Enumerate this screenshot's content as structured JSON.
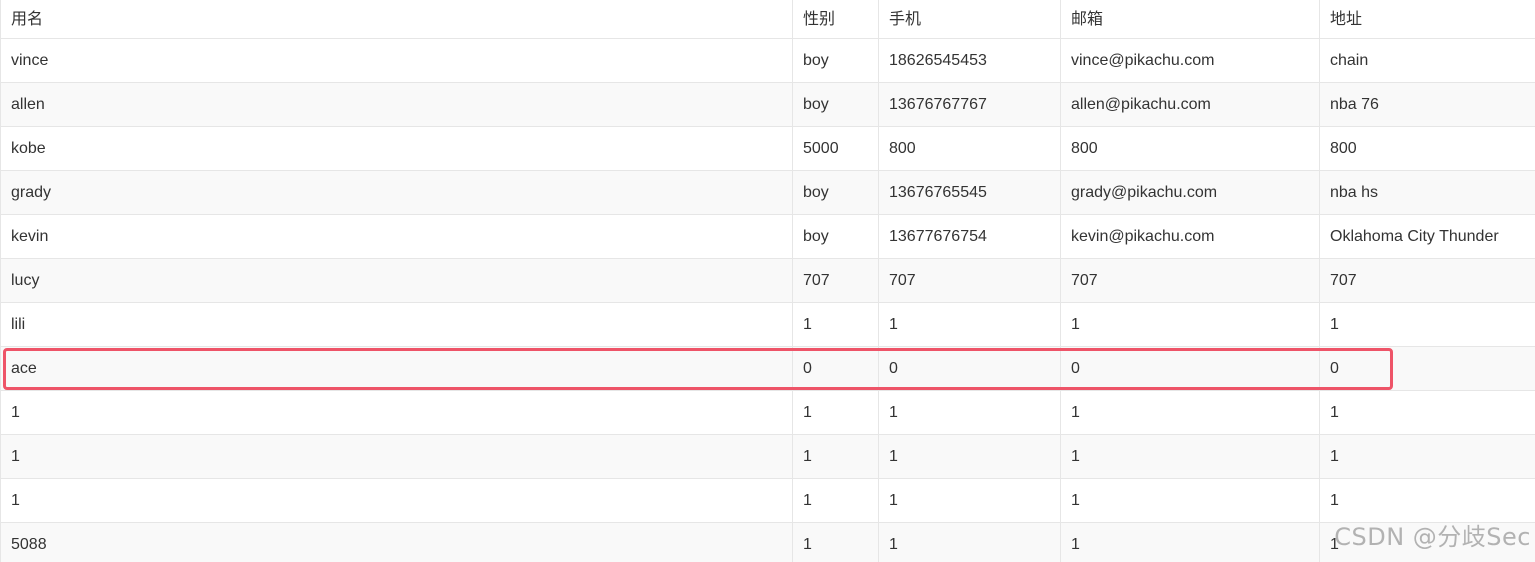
{
  "table": {
    "headers": [
      "用名",
      "性别",
      "手机",
      "邮箱",
      "地址"
    ],
    "rows": [
      [
        "vince",
        "boy",
        "18626545453",
        "vince@pikachu.com",
        "chain"
      ],
      [
        "allen",
        "boy",
        "13676767767",
        "allen@pikachu.com",
        "nba 76"
      ],
      [
        "kobe",
        "5000",
        "800",
        "800",
        "800"
      ],
      [
        "grady",
        "boy",
        "13676765545",
        "grady@pikachu.com",
        "nba hs"
      ],
      [
        "kevin",
        "boy",
        "13677676754",
        "kevin@pikachu.com",
        "Oklahoma City Thunder"
      ],
      [
        "lucy",
        "707",
        "707",
        "707",
        "707"
      ],
      [
        "lili",
        "1",
        "1",
        "1",
        "1"
      ],
      [
        "ace",
        "0",
        "0",
        "0",
        "0"
      ],
      [
        "1",
        "1",
        "1",
        "1",
        "1"
      ],
      [
        "1",
        "1",
        "1",
        "1",
        "1"
      ],
      [
        "1",
        "1",
        "1",
        "1",
        "1"
      ],
      [
        "5088",
        "1",
        "1",
        "1",
        "1"
      ]
    ]
  },
  "highlight": {
    "row_index": 7,
    "color": "#ee5468"
  },
  "watermark": "CSDN @分歧Sec"
}
